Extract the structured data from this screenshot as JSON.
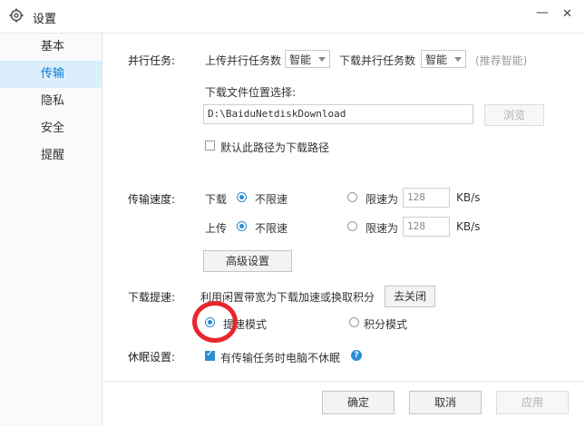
{
  "window": {
    "title": "设置",
    "minimize": "—",
    "close": "✕"
  },
  "sidebar": {
    "items": [
      {
        "label": "基本"
      },
      {
        "label": "传输"
      },
      {
        "label": "隐私"
      },
      {
        "label": "安全"
      },
      {
        "label": "提醒"
      }
    ]
  },
  "parallel": {
    "label": "并行任务:",
    "upload_label": "上传并行任务数",
    "upload_value": "智能",
    "download_label": "下载并行任务数",
    "download_value": "智能",
    "hint": "(推荐智能)"
  },
  "download_path": {
    "label": "下载文件位置选择:",
    "value": "D:\\BaiduNetdiskDownload",
    "browse": "浏览",
    "default_checkbox": "默认此路径为下载路径"
  },
  "speed": {
    "label": "传输速度:",
    "download_label": "下载",
    "upload_label": "上传",
    "unlimited": "不限速",
    "limit_to": "限速为",
    "download_limit": "128",
    "upload_limit": "128",
    "unit": "KB/s",
    "advanced": "高级设置"
  },
  "accel": {
    "label": "下载提速:",
    "desc": "利用闲置带宽为下载加速或换取积分",
    "close_btn": "去关闭",
    "mode_speed": "提速模式",
    "mode_points": "积分模式"
  },
  "sleep": {
    "label": "休眠设置:",
    "checkbox": "有传输任务时电脑不休眠",
    "help": "?"
  },
  "footer": {
    "ok": "确定",
    "cancel": "取消",
    "apply": "应用"
  },
  "colors": {
    "accent": "#2a8ed6",
    "active_bg": "#dbeefb",
    "highlight": "#e8262c"
  }
}
